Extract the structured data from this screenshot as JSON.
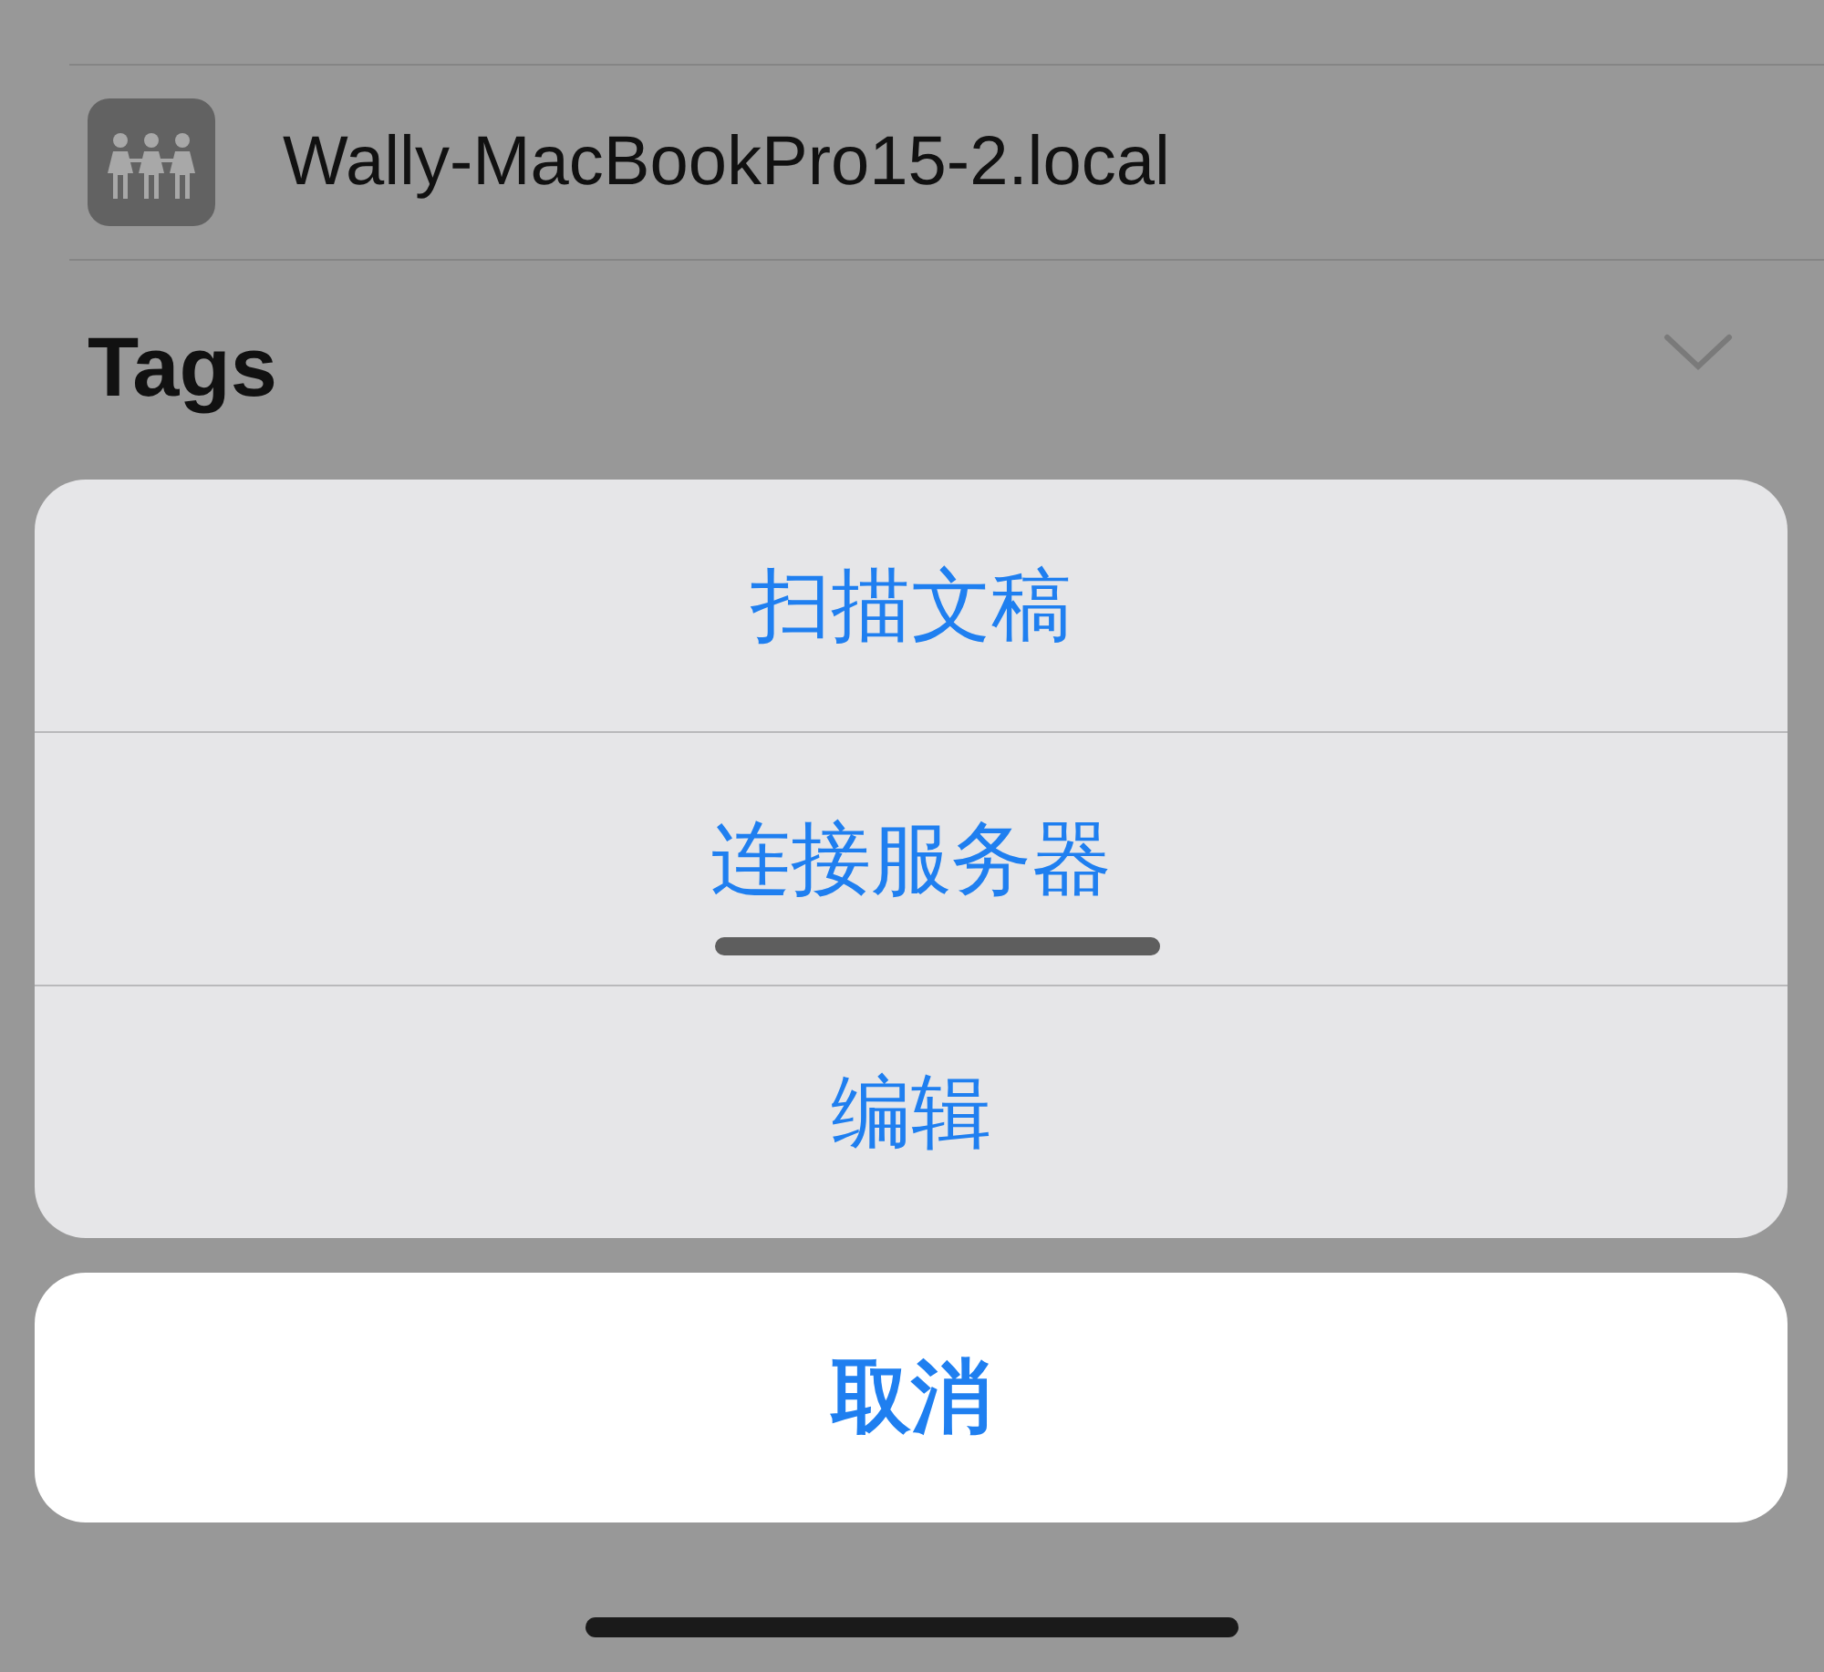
{
  "shared_list": {
    "items": [
      {
        "name": "Wally-MacBookPro15-2.local"
      }
    ]
  },
  "tags_section": {
    "title": "Tags",
    "expanded": false
  },
  "action_sheet": {
    "actions": [
      {
        "label": "扫描文稿",
        "marked": false
      },
      {
        "label": "连接服务器",
        "marked": true
      },
      {
        "label": "编辑",
        "marked": false
      }
    ],
    "cancel": {
      "label": "取消"
    }
  }
}
